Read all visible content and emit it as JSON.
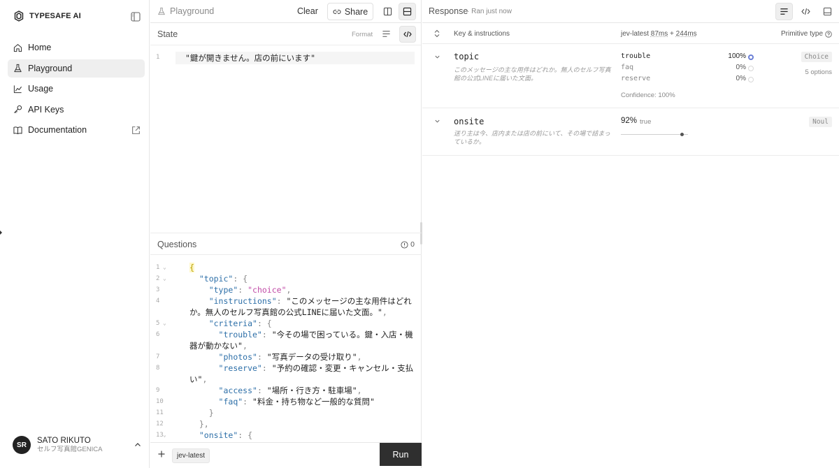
{
  "sidebar": {
    "brand": "TYPESAFE AI",
    "items": [
      {
        "label": "Home",
        "icon": "home-icon"
      },
      {
        "label": "Playground",
        "icon": "flask-icon"
      },
      {
        "label": "Usage",
        "icon": "chart-icon"
      },
      {
        "label": "API Keys",
        "icon": "key-icon"
      },
      {
        "label": "Documentation",
        "icon": "book-icon"
      }
    ],
    "user": {
      "initials": "SR",
      "name": "SATO RIKUTO",
      "org": "セルフ写真館GENICA"
    }
  },
  "playground": {
    "title": "Playground",
    "clear_label": "Clear",
    "share_label": "Share",
    "state": {
      "title": "State",
      "format_label": "Format",
      "line_number": "1",
      "value": "\"鍵が開きません。店の前にいます\""
    },
    "questions": {
      "title": "Questions",
      "count": "0",
      "code_lines": [
        {
          "n": "1",
          "fold": true
        },
        {
          "n": "2",
          "fold": true
        },
        {
          "n": "3",
          "fold": false
        },
        {
          "n": "4",
          "fold": false
        },
        {
          "n": "",
          "fold": false
        },
        {
          "n": "5",
          "fold": true
        },
        {
          "n": "6",
          "fold": false
        },
        {
          "n": "",
          "fold": false
        },
        {
          "n": "7",
          "fold": false
        },
        {
          "n": "8",
          "fold": false
        },
        {
          "n": "",
          "fold": false
        },
        {
          "n": "9",
          "fold": false
        },
        {
          "n": "10",
          "fold": false
        },
        {
          "n": "11",
          "fold": false
        },
        {
          "n": "12",
          "fold": false
        },
        {
          "n": "13",
          "fold": true
        }
      ]
    },
    "footer": {
      "model_tag": "jev-latest",
      "run_label": "Run"
    }
  },
  "response": {
    "title": "Response",
    "subtitle": "· Ran just now",
    "columns": {
      "key": "Key & instructions",
      "model": "jev-latest",
      "time_a": "87ms",
      "plus": "+",
      "time_b": "244ms",
      "primitive": "Primitive type"
    },
    "rows": [
      {
        "key": "topic",
        "instructions": "このメッセージの主な用件はどれか。無人のセルフ写真館の公式LINEに届いた文面。",
        "type": "Choice",
        "options_count": "5 options",
        "confidence": "Confidence: 100%",
        "options": [
          {
            "label": "trouble",
            "pct": "100%",
            "selected": true
          },
          {
            "label": "faq",
            "pct": "0%",
            "selected": false
          },
          {
            "label": "reserve",
            "pct": "0%",
            "selected": false
          }
        ]
      },
      {
        "key": "onsite",
        "instructions": "送り主は今、店内または店の前にいて、その場で詰まっているか。",
        "type": "Noul",
        "pct": "92%",
        "value": "true",
        "level": 0.92
      }
    ]
  }
}
